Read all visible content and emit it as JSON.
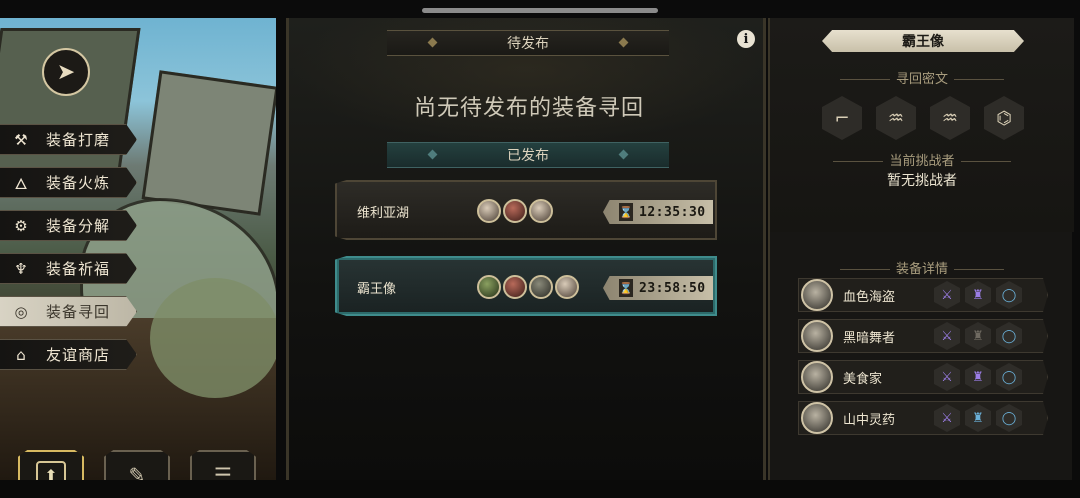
{
  "left_menu": {
    "items": [
      {
        "label": "装备打磨",
        "icon": "hammer-icon",
        "glyph": "⚒"
      },
      {
        "label": "装备火炼",
        "icon": "flame-icon",
        "glyph": "🜂"
      },
      {
        "label": "装备分解",
        "icon": "gear-break-icon",
        "glyph": "⚙"
      },
      {
        "label": "装备祈福",
        "icon": "blessing-icon",
        "glyph": "♆"
      },
      {
        "label": "装备寻回",
        "icon": "spiral-icon",
        "glyph": "◎",
        "active": true
      },
      {
        "label": "友谊商店",
        "icon": "shop-icon",
        "glyph": "⌂"
      }
    ]
  },
  "bottom_nav": {
    "items": [
      {
        "icon": "upload-icon",
        "glyph": "⬆",
        "active": true
      },
      {
        "icon": "feather-icon",
        "glyph": "✎"
      },
      {
        "icon": "list-icon",
        "glyph": "☰"
      }
    ]
  },
  "center": {
    "pending_header": "待发布",
    "pending_empty": "尚无待发布的装备寻回",
    "published_header": "已发布",
    "info_glyph": "i",
    "tasks": [
      {
        "name": "维利亚湖",
        "avatars": [
          "pale",
          "red",
          "pale"
        ],
        "time": "12:35:30",
        "selected": false
      },
      {
        "name": "霸王像",
        "avatars": [
          "green",
          "red",
          "default",
          "pale"
        ],
        "time": "23:58:50",
        "selected": true
      }
    ]
  },
  "right": {
    "title": "霸王像",
    "runes_label": "寻回密文",
    "runes": [
      "⌐",
      "♒",
      "♒",
      "⌬"
    ],
    "challenger_label": "当前挑战者",
    "challenger_value": "暂无挑战者",
    "equip_label": "装备详情",
    "equips": [
      {
        "name": "血色海盗",
        "slots": [
          {
            "glyph": "⚔",
            "tone": "purple"
          },
          {
            "glyph": "♜",
            "tone": "purple"
          },
          {
            "glyph": "◯",
            "tone": "blue"
          }
        ]
      },
      {
        "name": "黑暗舞者",
        "slots": [
          {
            "glyph": "⚔",
            "tone": "purple"
          },
          {
            "glyph": "♜",
            "tone": "gray"
          },
          {
            "glyph": "◯",
            "tone": "blue"
          }
        ]
      },
      {
        "name": "美食家",
        "slots": [
          {
            "glyph": "⚔",
            "tone": "purple"
          },
          {
            "glyph": "♜",
            "tone": "purple"
          },
          {
            "glyph": "◯",
            "tone": "blue"
          }
        ]
      },
      {
        "name": "山中灵药",
        "slots": [
          {
            "glyph": "⚔",
            "tone": "purple"
          },
          {
            "glyph": "♜",
            "tone": "blue"
          },
          {
            "glyph": "◯",
            "tone": "blue"
          }
        ]
      }
    ]
  },
  "colors": {
    "accent_teal": "#3f8c8c",
    "gold": "#d7b961",
    "purple_rarity": "#9b7de6",
    "blue_rarity": "#6ab0d8"
  }
}
